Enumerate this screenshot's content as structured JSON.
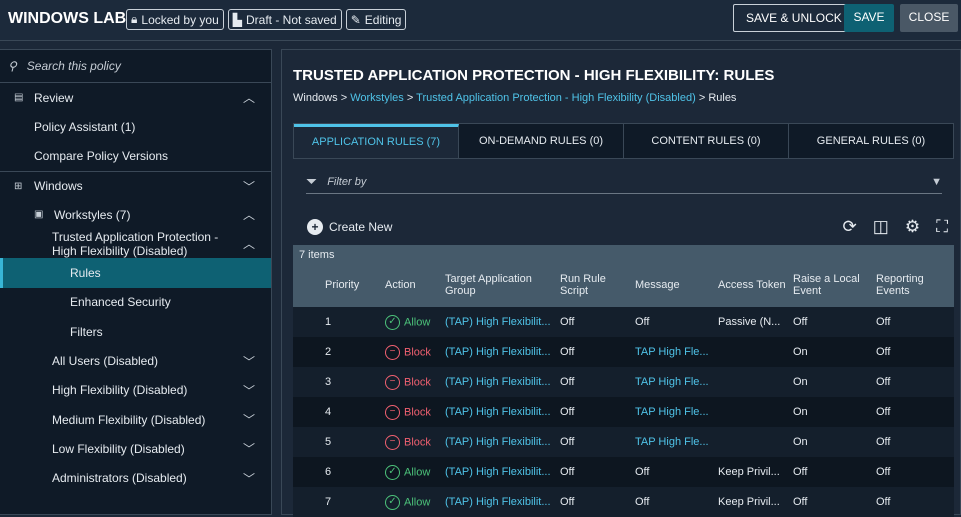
{
  "header": {
    "title": "WINDOWS LAB",
    "badges": [
      "Locked by you",
      "Draft - Not saved",
      "Editing"
    ],
    "save_unlock": "SAVE & UNLOCK",
    "save": "SAVE",
    "close": "CLOSE"
  },
  "sidebar": {
    "search_placeholder": "Search this policy",
    "items": [
      {
        "label": "Review",
        "level": 0,
        "icon": "review-icon",
        "chev": "up"
      },
      {
        "label": "Policy Assistant (1)",
        "level": 1
      },
      {
        "label": "Compare Policy Versions",
        "level": 1
      },
      {
        "label": "Windows",
        "level": 0,
        "icon": "windows-icon",
        "chev": "down"
      },
      {
        "label": "Workstyles (7)",
        "level": 1,
        "icon": "briefcase-icon",
        "chev": "up"
      },
      {
        "label": "Trusted Application Protection - High Flexibility (Disabled)",
        "level": 2,
        "chev": "up"
      },
      {
        "label": "Rules",
        "level": 3,
        "selected": true
      },
      {
        "label": "Enhanced Security",
        "level": 3
      },
      {
        "label": "Filters",
        "level": 3
      },
      {
        "label": "All Users (Disabled)",
        "level": 2,
        "chev": "down"
      },
      {
        "label": "High Flexibility (Disabled)",
        "level": 2,
        "chev": "down"
      },
      {
        "label": "Medium Flexibility (Disabled)",
        "level": 2,
        "chev": "down"
      },
      {
        "label": "Low Flexibility (Disabled)",
        "level": 2,
        "chev": "down"
      },
      {
        "label": "Administrators (Disabled)",
        "level": 2,
        "chev": "down"
      }
    ]
  },
  "main": {
    "title": "TRUSTED APPLICATION PROTECTION - HIGH FLEXIBILITY: RULES",
    "breadcrumb": [
      "Windows",
      ">",
      "Workstyles",
      ">",
      "Trusted Application Protection - High Flexibility (Disabled)",
      ">",
      "Rules"
    ],
    "tabs": [
      "APPLICATION RULES (7)",
      "ON-DEMAND RULES (0)",
      "CONTENT RULES (0)",
      "GENERAL RULES (0)"
    ],
    "filter_placeholder": "Filter by",
    "create_new": "Create New",
    "item_count": "7 items",
    "columns": [
      "Priority",
      "Action",
      "Target Application Group",
      "Run Rule Script",
      "Message",
      "Access Token",
      "Raise a Local Event",
      "Reporting Events"
    ],
    "rows": [
      [
        "1",
        "Allow",
        "(TAP) High Flexibilit...",
        "Off",
        "Off",
        "Passive (N...",
        "Off",
        "Off"
      ],
      [
        "2",
        "Block",
        "(TAP) High Flexibilit...",
        "Off",
        "TAP High Fle...",
        "",
        "On",
        "Off"
      ],
      [
        "3",
        "Block",
        "(TAP) High Flexibilit...",
        "Off",
        "TAP High Fle...",
        "",
        "On",
        "Off"
      ],
      [
        "4",
        "Block",
        "(TAP) High Flexibilit...",
        "Off",
        "TAP High Fle...",
        "",
        "On",
        "Off"
      ],
      [
        "5",
        "Block",
        "(TAP) High Flexibilit...",
        "Off",
        "TAP High Fle...",
        "",
        "On",
        "Off"
      ],
      [
        "6",
        "Allow",
        "(TAP) High Flexibilit...",
        "Off",
        "Off",
        "Keep Privil...",
        "Off",
        "Off"
      ],
      [
        "7",
        "Allow",
        "(TAP) High Flexibilit...",
        "Off",
        "Off",
        "Keep Privil...",
        "Off",
        "Off"
      ]
    ]
  }
}
